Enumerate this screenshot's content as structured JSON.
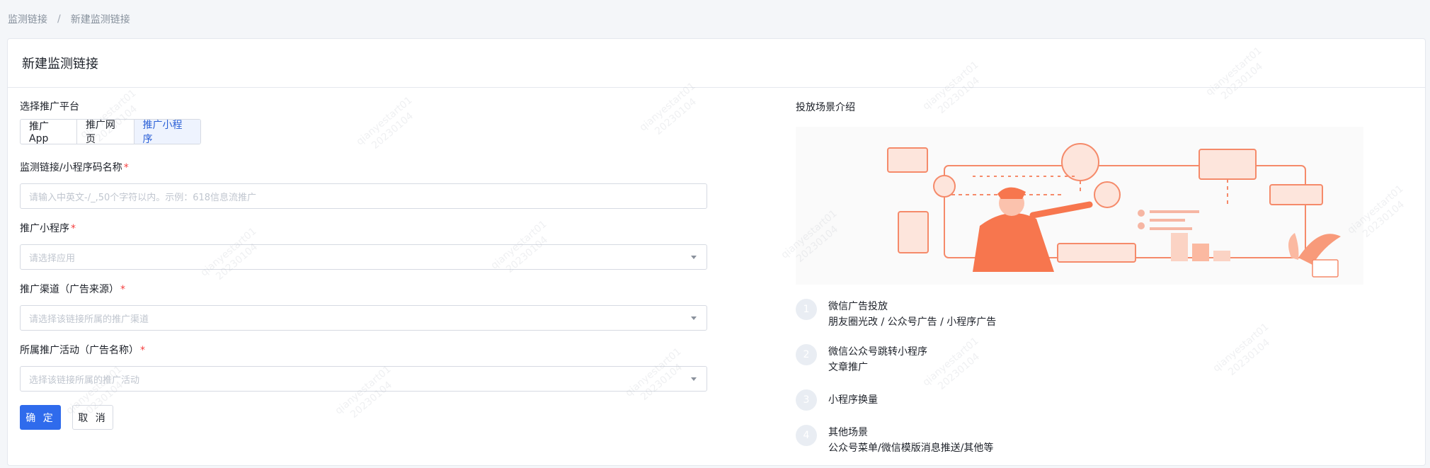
{
  "breadcrumb": {
    "parent": "监测链接",
    "separator": "/",
    "current": "新建监测链接"
  },
  "page_title": "新建监测链接",
  "form": {
    "platform_label": "选择推广平台",
    "platform_options": [
      "推广App",
      "推广网页",
      "推广小程序"
    ],
    "platform_selected": "推广小程序",
    "name_label": "监测链接/小程序码名称",
    "name_placeholder": "请输入中英文-/_,50个字符以内。示例：618信息流推广",
    "miniprogram_label": "推广小程序",
    "miniprogram_placeholder": "请选择应用",
    "channel_label": "推广渠道（广告来源）",
    "channel_placeholder": "请选择该链接所属的推广渠道",
    "activity_label": "所属推广活动（广告名称）",
    "activity_placeholder": "选择该链接所属的推广活动",
    "required_mark": "*",
    "confirm": "确 定",
    "cancel": "取 消"
  },
  "scenes_panel": {
    "title": "投放场景介绍",
    "items": [
      {
        "num": "1",
        "title": "微信广告投放",
        "desc": "朋友圈光改 / 公众号广告 / 小程序广告"
      },
      {
        "num": "2",
        "title": "微信公众号跳转小程序",
        "desc": "文章推广"
      },
      {
        "num": "3",
        "title": "小程序换量",
        "desc": ""
      },
      {
        "num": "4",
        "title": "其他场景",
        "desc": "公众号菜单/微信模版消息推送/其他等"
      }
    ]
  },
  "watermark": {
    "line1": "qianyestart01",
    "line2": "20230104"
  },
  "colors": {
    "primary": "#2f6bec",
    "accent_illustration": "#f58a6a"
  }
}
